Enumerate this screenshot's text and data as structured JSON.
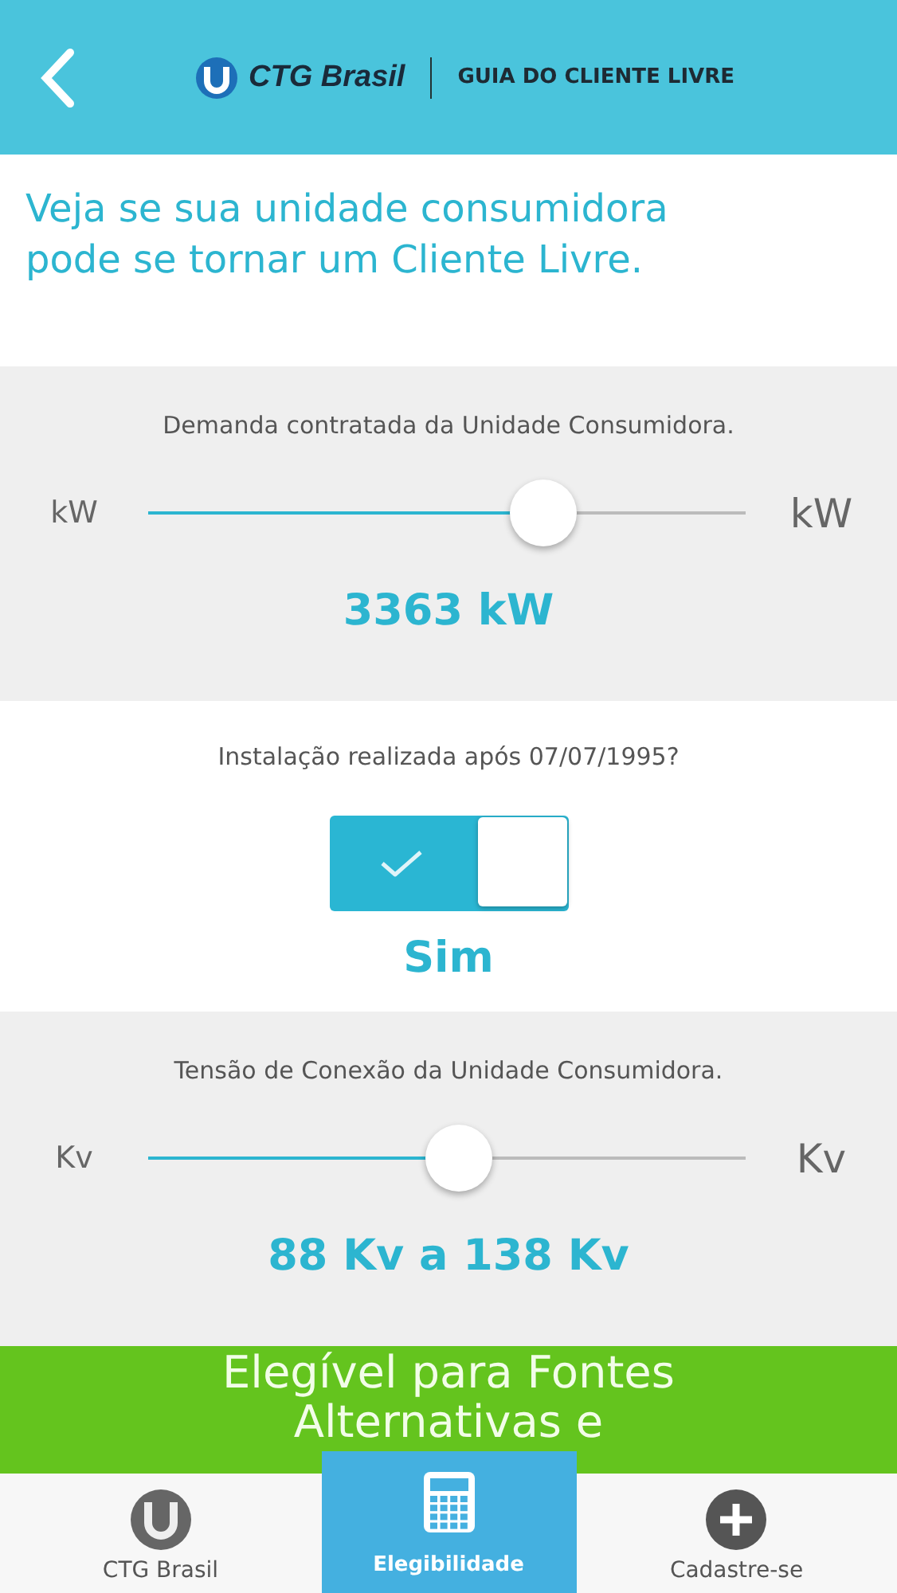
{
  "header": {
    "brand": "CTG Brasil",
    "title": "GUIA DO CLIENTE LIVRE"
  },
  "heading": "Veja se sua unidade consumidora pode se tornar um Cliente Livre.",
  "sections": [
    {
      "kind": "slider",
      "label": "Demanda contratada da Unidade Consumidora.",
      "min_unit": "kW",
      "max_unit": "kW",
      "level": 0.66,
      "reading": "3363 kW"
    },
    {
      "kind": "toggle",
      "label": "Instalação realizada após 07/07/1995?",
      "on": true,
      "reading": "Sim"
    },
    {
      "kind": "slider",
      "label": "Tensão de Conexão da Unidade Consumidora.",
      "min_unit": "Kv",
      "max_unit": "Kv",
      "level": 0.52,
      "reading": "88 Kv a 138 Kv"
    }
  ],
  "result": "Elegível para Fontes Alternativas e",
  "tabs": [
    {
      "kind": "logo",
      "label": "CTG Brasil",
      "selected": false
    },
    {
      "kind": "calculator",
      "label": "Elegibilidade",
      "selected": true
    },
    {
      "kind": "plus",
      "label": "Cadastre-se",
      "selected": false
    }
  ]
}
